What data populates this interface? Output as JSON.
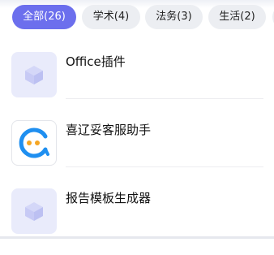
{
  "tabs": [
    {
      "label": "全部(26)",
      "active": true
    },
    {
      "label": "学术(4)",
      "active": false
    },
    {
      "label": "法务(3)",
      "active": false
    },
    {
      "label": "生活(2)",
      "active": false
    }
  ],
  "plugins": [
    {
      "title": "Office插件",
      "icon": "cube-placeholder-icon"
    },
    {
      "title": "喜辽妥客服助手",
      "icon": "headset-logo-icon"
    },
    {
      "title": "报告模板生成器",
      "icon": "cube-placeholder-icon"
    }
  ],
  "colors": {
    "accent": "#6c6fed",
    "tab_inactive_bg": "#eceef2",
    "placeholder_bg": "#e9ebfb",
    "placeholder_icon": "#c7caf5",
    "logo_blue": "#1f8ff0",
    "logo_orange": "#f5a623"
  }
}
